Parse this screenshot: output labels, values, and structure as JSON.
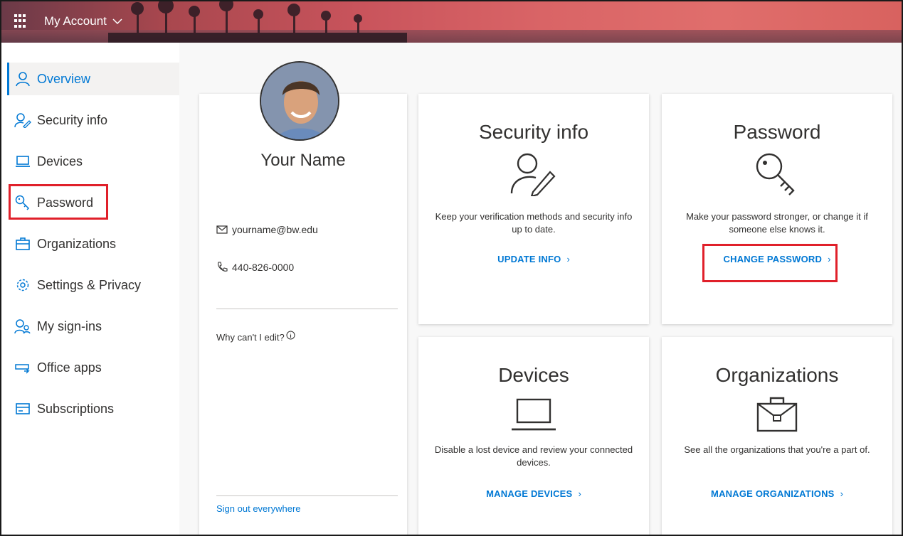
{
  "header": {
    "app_title": "My Account"
  },
  "sidebar": {
    "items": [
      {
        "label": "Overview",
        "icon": "person-icon"
      },
      {
        "label": "Security info",
        "icon": "person-edit-icon"
      },
      {
        "label": "Devices",
        "icon": "laptop-icon"
      },
      {
        "label": "Password",
        "icon": "key-icon"
      },
      {
        "label": "Organizations",
        "icon": "briefcase-icon"
      },
      {
        "label": "Settings & Privacy",
        "icon": "gear-icon"
      },
      {
        "label": "My sign-ins",
        "icon": "people-icon"
      },
      {
        "label": "Office apps",
        "icon": "office-apps-icon"
      },
      {
        "label": "Subscriptions",
        "icon": "card-icon"
      }
    ],
    "active_index": 0
  },
  "profile": {
    "name": "Your Name",
    "email": "yourname@bw.edu",
    "phone": "440-826-0000",
    "why_cant_edit": "Why can't I edit?",
    "sign_out": "Sign out everywhere"
  },
  "cards": {
    "security": {
      "title": "Security info",
      "description": "Keep your verification methods and security info up to date.",
      "link": "UPDATE INFO"
    },
    "password": {
      "title": "Password",
      "description": "Make your password stronger, or change it if someone else knows it.",
      "link": "CHANGE PASSWORD"
    },
    "devices": {
      "title": "Devices",
      "description": "Disable a lost device and review your connected devices.",
      "link": "MANAGE DEVICES"
    },
    "organizations": {
      "title": "Organizations",
      "description": "See all the organizations that you're a part of.",
      "link": "MANAGE ORGANIZATIONS"
    }
  },
  "colors": {
    "accent": "#0078d4",
    "highlight_box": "#e0202a",
    "text": "#323130"
  }
}
